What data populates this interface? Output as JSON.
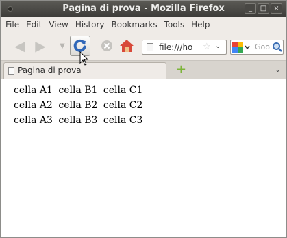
{
  "window": {
    "title": "Pagina di prova - Mozilla Firefox",
    "controls": [
      "_",
      "□",
      "×"
    ]
  },
  "menu": [
    "File",
    "Edit",
    "View",
    "History",
    "Bookmarks",
    "Tools",
    "Help"
  ],
  "navbar": {
    "url": "file:///ho",
    "search_placeholder": "Goo"
  },
  "tabs": [
    {
      "label": "Pagina di prova",
      "active": true
    }
  ],
  "new_tab_symbol": "+",
  "content": {
    "rows": [
      [
        "cella A1",
        "cella B1",
        "cella C1"
      ],
      [
        "cella A2",
        "cella B2",
        "cella C2"
      ],
      [
        "cella A3",
        "cella B3",
        "cella C3"
      ]
    ]
  },
  "icons": {
    "back": "back-arrow-icon",
    "forward": "forward-arrow-icon",
    "reload": "reload-icon",
    "stop": "stop-icon",
    "home": "home-icon",
    "bookmark": "star-icon",
    "search": "magnifier-icon"
  }
}
